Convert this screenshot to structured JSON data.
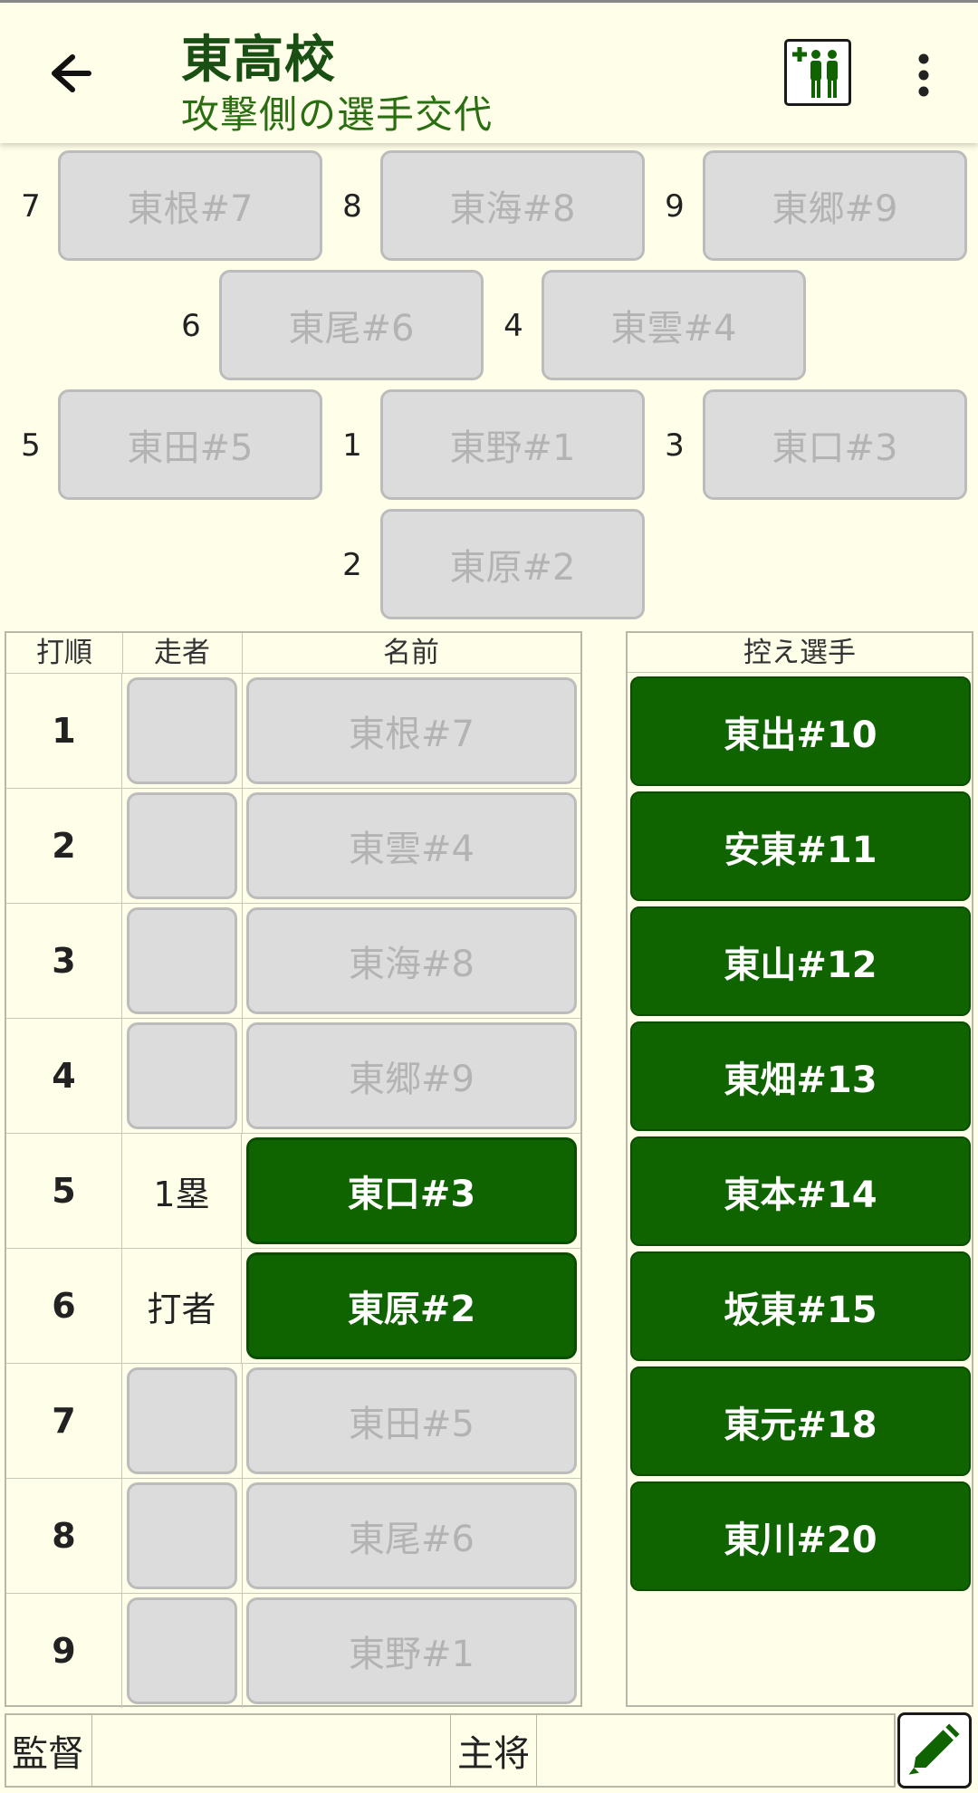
{
  "appbar": {
    "title": "東高校",
    "subtitle": "攻撃側の選手交代",
    "back_icon": "arrow-left-icon",
    "substitute_icon": "add-players-icon",
    "more_icon": "more-vert-icon"
  },
  "field": {
    "positions": [
      {
        "number": "7",
        "player": "東根#7"
      },
      {
        "number": "8",
        "player": "東海#8"
      },
      {
        "number": "9",
        "player": "東郷#9"
      },
      {
        "number": "6",
        "player": "東尾#6"
      },
      {
        "number": "4",
        "player": "東雲#4"
      },
      {
        "number": "5",
        "player": "東田#5"
      },
      {
        "number": "1",
        "player": "東野#1"
      },
      {
        "number": "3",
        "player": "東口#3"
      },
      {
        "number": "2",
        "player": "東原#2"
      }
    ]
  },
  "lineup": {
    "headers": {
      "order": "打順",
      "runner": "走者",
      "name": "名前"
    },
    "rows": [
      {
        "order": "1",
        "runner": "",
        "name": "東根#7",
        "active": false
      },
      {
        "order": "2",
        "runner": "",
        "name": "東雲#4",
        "active": false
      },
      {
        "order": "3",
        "runner": "",
        "name": "東海#8",
        "active": false
      },
      {
        "order": "4",
        "runner": "",
        "name": "東郷#9",
        "active": false
      },
      {
        "order": "5",
        "runner": "1塁",
        "name": "東口#3",
        "active": true
      },
      {
        "order": "6",
        "runner": "打者",
        "name": "東原#2",
        "active": true
      },
      {
        "order": "7",
        "runner": "",
        "name": "東田#5",
        "active": false
      },
      {
        "order": "8",
        "runner": "",
        "name": "東尾#6",
        "active": false
      },
      {
        "order": "9",
        "runner": "",
        "name": "東野#1",
        "active": false
      }
    ]
  },
  "bench": {
    "header": "控え選手",
    "players": [
      "東出#10",
      "安東#11",
      "東山#12",
      "東畑#13",
      "東本#14",
      "坂東#15",
      "東元#18",
      "東川#20"
    ]
  },
  "footer": {
    "manager_label": "監督",
    "manager_value": "",
    "captain_label": "主将",
    "captain_value": "",
    "edit_icon": "pencil-icon"
  },
  "colors": {
    "background": "#fffee8",
    "accent_green": "#0f6400",
    "title_green": "#1a4f13",
    "disabled_gray": "#dcdcdc"
  }
}
